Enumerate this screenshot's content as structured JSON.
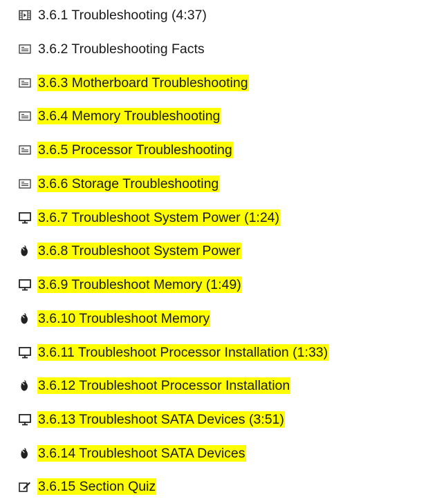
{
  "lessons": [
    {
      "label": "3.6.1 Troubleshooting (4:37)",
      "icon": "video-icon",
      "highlighted": false
    },
    {
      "label": "3.6.2 Troubleshooting Facts",
      "icon": "document-icon",
      "highlighted": false
    },
    {
      "label": "3.6.3 Motherboard Troubleshooting",
      "icon": "document-icon",
      "highlighted": true
    },
    {
      "label": "3.6.4 Memory Troubleshooting",
      "icon": "document-icon",
      "highlighted": true
    },
    {
      "label": "3.6.5 Processor Troubleshooting",
      "icon": "document-icon",
      "highlighted": true
    },
    {
      "label": "3.6.6 Storage Troubleshooting",
      "icon": "document-icon",
      "highlighted": true
    },
    {
      "label": "3.6.7 Troubleshoot System Power (1:24)",
      "icon": "monitor-icon",
      "highlighted": true
    },
    {
      "label": "3.6.8 Troubleshoot System Power",
      "icon": "mouse-icon",
      "highlighted": true
    },
    {
      "label": "3.6.9 Troubleshoot Memory (1:49)",
      "icon": "monitor-icon",
      "highlighted": true
    },
    {
      "label": "3.6.10 Troubleshoot Memory",
      "icon": "mouse-icon",
      "highlighted": true
    },
    {
      "label": "3.6.11 Troubleshoot Processor Installation (1:33)",
      "icon": "monitor-icon",
      "highlighted": true
    },
    {
      "label": "3.6.12 Troubleshoot Processor Installation",
      "icon": "mouse-icon",
      "highlighted": true
    },
    {
      "label": "3.6.13 Troubleshoot SATA Devices (3:51)",
      "icon": "monitor-icon",
      "highlighted": true
    },
    {
      "label": "3.6.14 Troubleshoot SATA Devices",
      "icon": "mouse-icon",
      "highlighted": true
    },
    {
      "label": "3.6.15 Section Quiz",
      "icon": "quiz-icon",
      "highlighted": true
    }
  ],
  "colors": {
    "highlight": "#ffff00",
    "text": "#1a1a1a",
    "icon": "#333333"
  }
}
